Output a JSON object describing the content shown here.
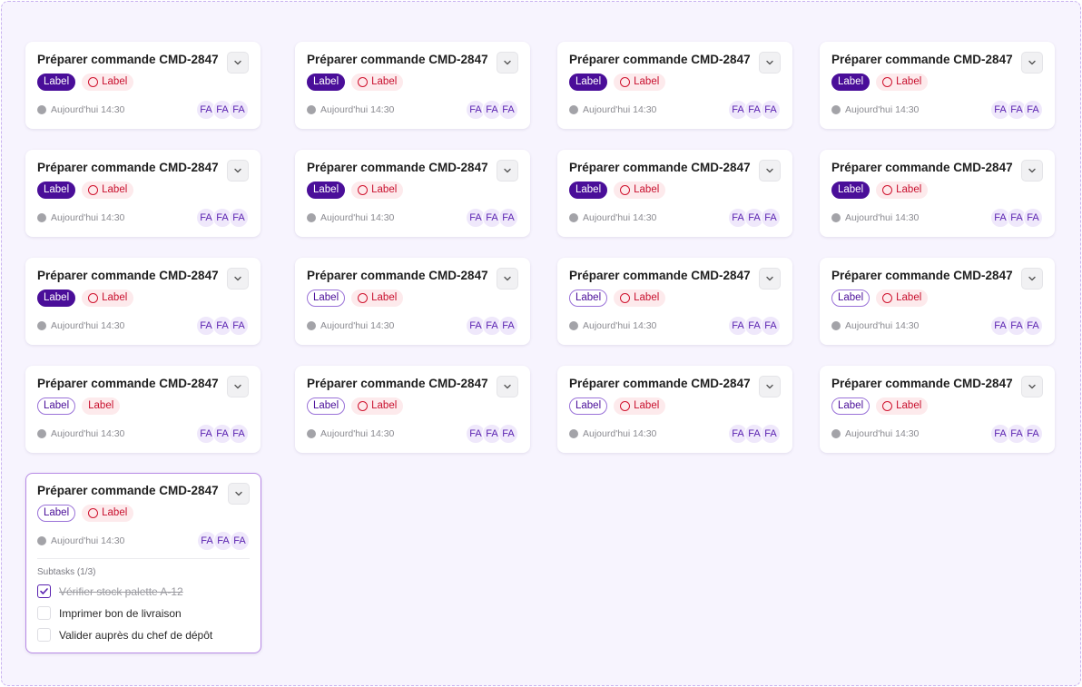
{
  "cards": [
    {
      "title": "Préparer commande CMD-2847",
      "tag1": "Label",
      "tag1_style": "solid",
      "tag2": "Label",
      "tag2_ring": true,
      "time": "Aujourd'hui 14:30",
      "avatars": [
        "FA",
        "FA",
        "FA"
      ]
    },
    {
      "title": "Préparer commande CMD-2847",
      "tag1": "Label",
      "tag1_style": "solid",
      "tag2": "Label",
      "tag2_ring": true,
      "time": "Aujourd'hui 14:30",
      "avatars": [
        "FA",
        "FA",
        "FA"
      ]
    },
    {
      "title": "Préparer commande CMD-2847",
      "tag1": "Label",
      "tag1_style": "solid",
      "tag2": "Label",
      "tag2_ring": true,
      "time": "Aujourd'hui 14:30",
      "avatars": [
        "FA",
        "FA",
        "FA"
      ]
    },
    {
      "title": "Préparer commande CMD-2847",
      "tag1": "Label",
      "tag1_style": "solid",
      "tag2": "Label",
      "tag2_ring": true,
      "time": "Aujourd'hui 14:30",
      "avatars": [
        "FA",
        "FA",
        "FA"
      ]
    },
    {
      "title": "Préparer commande CMD-2847",
      "tag1": "Label",
      "tag1_style": "solid",
      "tag2": "Label",
      "tag2_ring": true,
      "time": "Aujourd'hui 14:30",
      "avatars": [
        "FA",
        "FA",
        "FA"
      ]
    },
    {
      "title": "Préparer commande CMD-2847",
      "tag1": "Label",
      "tag1_style": "solid",
      "tag2": "Label",
      "tag2_ring": true,
      "time": "Aujourd'hui 14:30",
      "avatars": [
        "FA",
        "FA",
        "FA"
      ]
    },
    {
      "title": "Préparer commande CMD-2847",
      "tag1": "Label",
      "tag1_style": "solid",
      "tag2": "Label",
      "tag2_ring": true,
      "time": "Aujourd'hui 14:30",
      "avatars": [
        "FA",
        "FA",
        "FA"
      ]
    },
    {
      "title": "Préparer commande CMD-2847",
      "tag1": "Label",
      "tag1_style": "solid",
      "tag2": "Label",
      "tag2_ring": true,
      "time": "Aujourd'hui 14:30",
      "avatars": [
        "FA",
        "FA",
        "FA"
      ]
    },
    {
      "title": "Préparer commande CMD-2847",
      "tag1": "Label",
      "tag1_style": "solid",
      "tag2": "Label",
      "tag2_ring": true,
      "time": "Aujourd'hui 14:30",
      "avatars": [
        "FA",
        "FA",
        "FA"
      ]
    },
    {
      "title": "Préparer commande CMD-2847",
      "tag1": "Label",
      "tag1_style": "outline",
      "tag2": "Label",
      "tag2_ring": true,
      "time": "Aujourd'hui 14:30",
      "avatars": [
        "FA",
        "FA",
        "FA"
      ]
    },
    {
      "title": "Préparer commande CMD-2847",
      "tag1": "Label",
      "tag1_style": "outline",
      "tag2": "Label",
      "tag2_ring": true,
      "time": "Aujourd'hui 14:30",
      "avatars": [
        "FA",
        "FA",
        "FA"
      ]
    },
    {
      "title": "Préparer commande CMD-2847",
      "tag1": "Label",
      "tag1_style": "outline",
      "tag2": "Label",
      "tag2_ring": true,
      "time": "Aujourd'hui 14:30",
      "avatars": [
        "FA",
        "FA",
        "FA"
      ]
    },
    {
      "title": "Préparer commande CMD-2847",
      "tag1": "Label",
      "tag1_style": "outline",
      "tag2": "Label",
      "tag2_ring": false,
      "time": "Aujourd'hui 14:30",
      "avatars": [
        "FA",
        "FA",
        "FA"
      ]
    },
    {
      "title": "Préparer commande CMD-2847",
      "tag1": "Label",
      "tag1_style": "outline",
      "tag2": "Label",
      "tag2_ring": true,
      "time": "Aujourd'hui 14:30",
      "avatars": [
        "FA",
        "FA",
        "FA"
      ]
    },
    {
      "title": "Préparer commande CMD-2847",
      "tag1": "Label",
      "tag1_style": "outline",
      "tag2": "Label",
      "tag2_ring": true,
      "time": "Aujourd'hui 14:30",
      "avatars": [
        "FA",
        "FA",
        "FA"
      ]
    },
    {
      "title": "Préparer commande CMD-2847",
      "tag1": "Label",
      "tag1_style": "outline",
      "tag2": "Label",
      "tag2_ring": true,
      "time": "Aujourd'hui 14:30",
      "avatars": [
        "FA",
        "FA",
        "FA"
      ]
    }
  ],
  "expanded_card": {
    "title": "Préparer commande CMD-2847",
    "tag1": "Label",
    "tag2": "Label",
    "time": "Aujourd'hui 14:30",
    "avatars": [
      "FA",
      "FA",
      "FA"
    ],
    "subtasks_heading": "Subtasks (1/3)",
    "subtasks": [
      {
        "label": "Vérifier stock palette A-12",
        "done": true
      },
      {
        "label": "Imprimer bon de livraison",
        "done": false
      },
      {
        "label": "Valider auprès du chef de dépôt",
        "done": false
      }
    ]
  },
  "colors": {
    "accent": "#4a0e99",
    "tag_red": "#c8102e",
    "canvas_bg": "#f7f4fe"
  },
  "icons": {
    "expand": "chevron-down-icon",
    "time": "status-dot-icon",
    "check": "check-icon"
  }
}
